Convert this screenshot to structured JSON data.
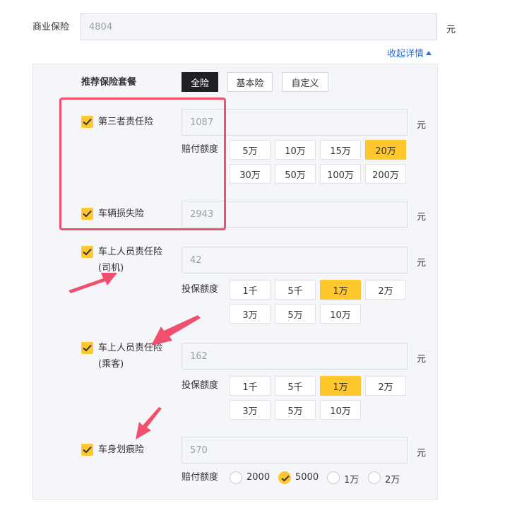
{
  "commercial": {
    "label": "商业保险",
    "value": "4804",
    "unit": "元",
    "collapse": "收起详情"
  },
  "package": {
    "label": "推荐保险套餐",
    "tabs": [
      {
        "label": "全险",
        "active": true
      },
      {
        "label": "基本险",
        "active": false
      },
      {
        "label": "自定义",
        "active": false
      }
    ]
  },
  "third_party": {
    "label": "第三者责任险",
    "value": "1087",
    "unit": "元",
    "amount_label": "赔付额度",
    "options": [
      "5万",
      "10万",
      "15万",
      "20万",
      "30万",
      "50万",
      "100万",
      "200万"
    ],
    "selected": "20万"
  },
  "vehicle_loss": {
    "label": "车辆损失险",
    "value": "2943",
    "unit": "元"
  },
  "driver": {
    "label_line1": "车上人员责任险",
    "label_line2": "(司机)",
    "value": "42",
    "unit": "元",
    "amount_label": "投保额度",
    "options": [
      "1千",
      "5千",
      "1万",
      "2万",
      "3万",
      "5万",
      "10万"
    ],
    "selected": "1万"
  },
  "passenger": {
    "label_line1": "车上人员责任险",
    "label_line2": "(乘客)",
    "value": "162",
    "unit": "元",
    "amount_label": "投保额度",
    "options": [
      "1千",
      "5千",
      "1万",
      "2万",
      "3万",
      "5万",
      "10万"
    ],
    "selected": "1万"
  },
  "scratch": {
    "label": "车身划痕险",
    "value": "570",
    "unit": "元",
    "amount_label": "赔付额度",
    "options": [
      "2000",
      "5000",
      "1万",
      "2万"
    ],
    "selected": "5000"
  },
  "colors": {
    "accent": "#ffc72c",
    "dark_tab": "#1f1f24",
    "annotation": "#f0506e",
    "link": "#2f6fd6"
  }
}
